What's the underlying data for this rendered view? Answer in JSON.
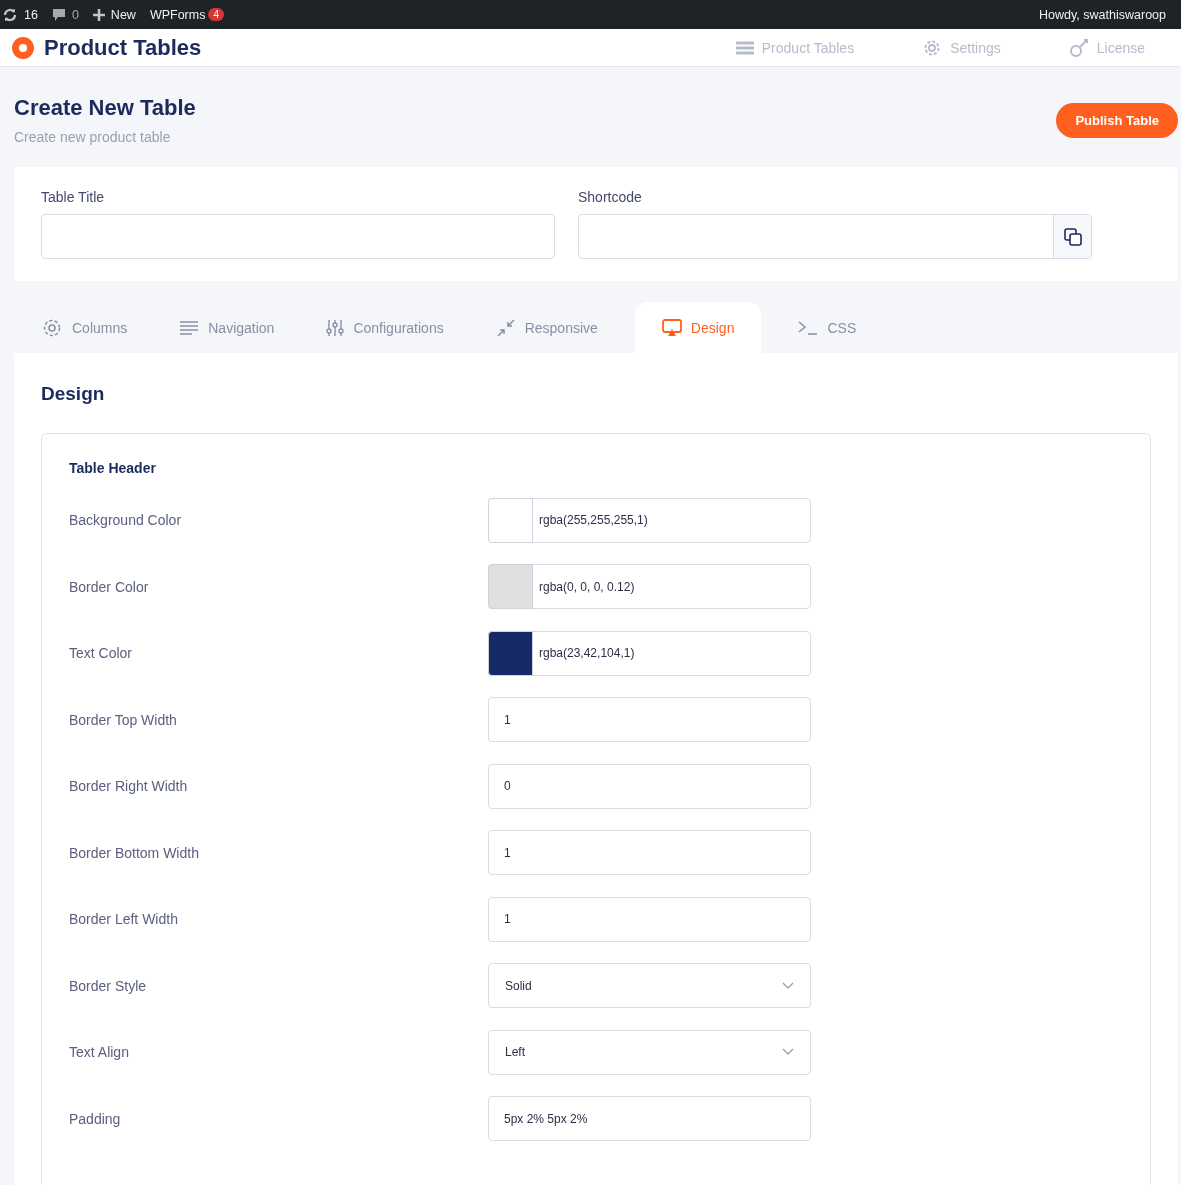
{
  "admin_bar": {
    "updates": "16",
    "comments": "0",
    "new": "New",
    "wpforms": "WPForms",
    "wpforms_badge": "4",
    "greeting": "Howdy, swathiswaroop"
  },
  "header": {
    "title": "Product Tables",
    "nav": [
      {
        "label": "Product Tables",
        "kind": "list"
      },
      {
        "label": "Settings",
        "kind": "gear"
      },
      {
        "label": "License",
        "kind": "key"
      }
    ]
  },
  "page": {
    "title": "Create New Table",
    "subtitle": "Create new product table",
    "publish": "Publish Table"
  },
  "table_fields": [
    {
      "label": "Table Title",
      "kind": "text"
    },
    {
      "label": "Shortcode",
      "kind": "copy"
    }
  ],
  "tabs": [
    {
      "label": "Columns",
      "kind": "gear",
      "selected": false
    },
    {
      "label": "Navigation",
      "kind": "lines",
      "selected": false
    },
    {
      "label": "Configurations",
      "kind": "sliders",
      "selected": false
    },
    {
      "label": "Responsive",
      "kind": "shrink",
      "selected": false
    },
    {
      "label": "Design",
      "kind": "screen",
      "selected": true
    },
    {
      "label": "CSS",
      "kind": "terminal",
      "selected": false
    }
  ],
  "design": {
    "title": "Design",
    "section": "Table Header",
    "rows": [
      {
        "label": "Background Color",
        "kind": "color",
        "value": "rgba(255,255,255,1)",
        "color": "#ffffff"
      },
      {
        "label": "Border Color",
        "kind": "color",
        "value": "rgba(0, 0, 0, 0.12)",
        "color": "#e0e0e0"
      },
      {
        "label": "Text Color",
        "kind": "color",
        "value": "rgba(23,42,104,1)",
        "color": "#172a68"
      },
      {
        "label": "Border Top Width",
        "kind": "text",
        "value": "1"
      },
      {
        "label": "Border Right Width",
        "kind": "text",
        "value": "0"
      },
      {
        "label": "Border Bottom Width",
        "kind": "text",
        "value": "1"
      },
      {
        "label": "Border Left Width",
        "kind": "text",
        "value": "1"
      },
      {
        "label": "Border Style",
        "kind": "select",
        "value": "Solid"
      },
      {
        "label": "Text Align",
        "kind": "select",
        "value": "Left"
      },
      {
        "label": "Padding",
        "kind": "text",
        "value": "5px 2% 5px 2%"
      }
    ]
  }
}
